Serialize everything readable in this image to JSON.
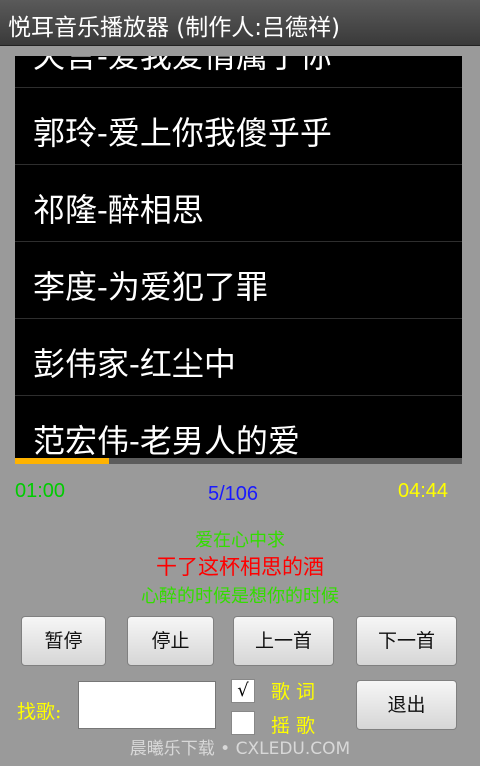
{
  "app": {
    "title": "悦耳音乐播放器 (制作人:吕德祥)"
  },
  "playlist": {
    "items": [
      {
        "label": "天言-爱我爱情属于你"
      },
      {
        "label": "郭玲-爱上你我傻乎乎"
      },
      {
        "label": "祁隆-醉相思"
      },
      {
        "label": "李度-为爱犯了罪"
      },
      {
        "label": "彭伟家-红尘中"
      },
      {
        "label": "范宏伟-老男人的爱"
      }
    ]
  },
  "player": {
    "progress": 0.21,
    "elapsed": "01:00",
    "track_index": "5/106",
    "total": "04:44",
    "progress_color": "#ffb300"
  },
  "lyrics": {
    "previous": "爱在心中求",
    "current": "干了这杯相思的酒",
    "next": "心醉的时候是想你的时候"
  },
  "controls": {
    "pause": "暂停",
    "stop": "停止",
    "previous": "上一首",
    "next": "下一首",
    "exit": "退出"
  },
  "search": {
    "label": "找歌:",
    "value": "",
    "lyrics_checkbox": {
      "label": "歌 词",
      "checked": true,
      "mark": "√"
    },
    "shuffle_checkbox": {
      "label": "摇 歌",
      "checked": false,
      "mark": ""
    }
  },
  "watermark": "晨曦乐下载 • CXLEDU.COM"
}
